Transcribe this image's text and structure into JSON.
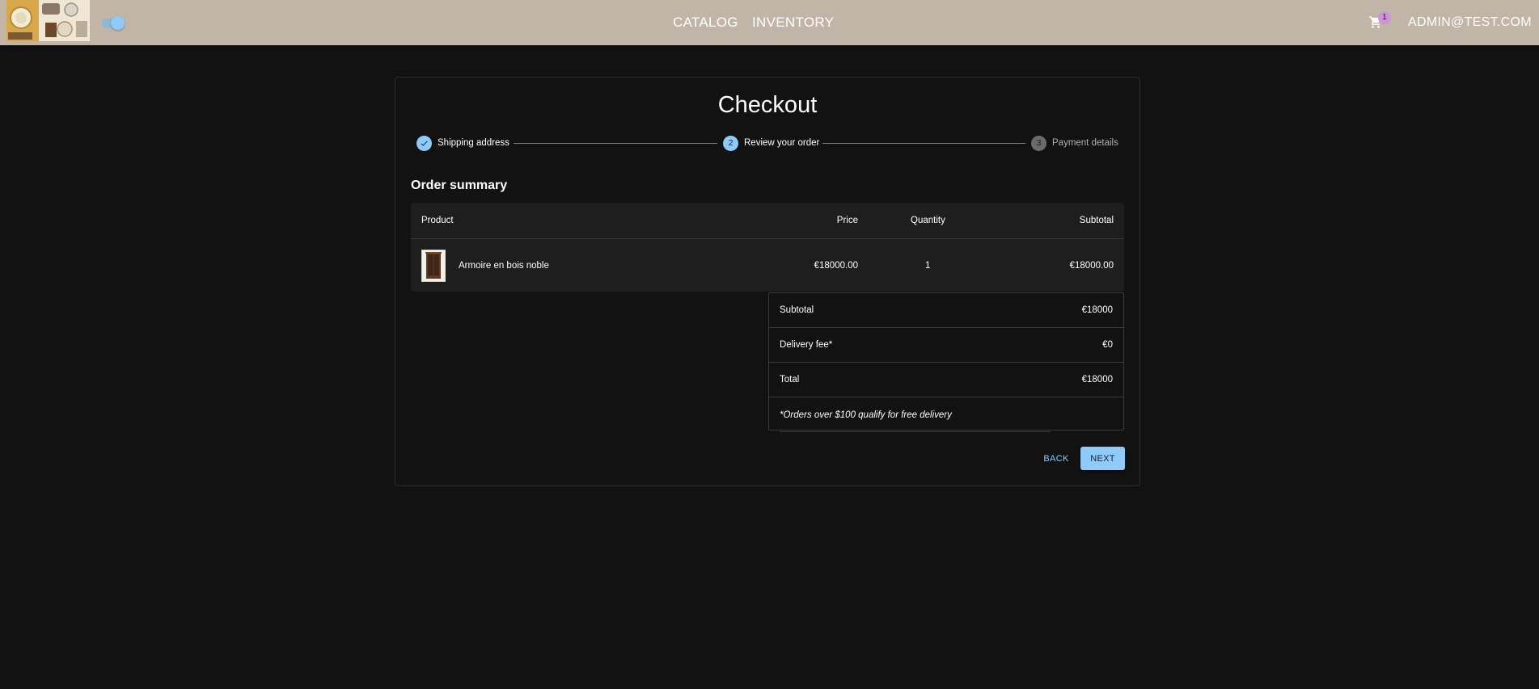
{
  "header": {
    "nav": [
      "CATALOG",
      "INVENTORY"
    ],
    "cart_count": "1",
    "user": "ADMIN@TEST.COM"
  },
  "checkout": {
    "title": "Checkout",
    "steps": [
      {
        "label": "Shipping address",
        "number": "",
        "state": "completed"
      },
      {
        "label": "Review your order",
        "number": "2",
        "state": "active"
      },
      {
        "label": "Payment details",
        "number": "3",
        "state": "pending"
      }
    ],
    "section_title": "Order summary",
    "table": {
      "headers": [
        "Product",
        "Price",
        "Quantity",
        "Subtotal"
      ],
      "rows": [
        {
          "product": "Armoire en bois noble",
          "price": "€18000.00",
          "quantity": "1",
          "subtotal": "€18000.00"
        }
      ]
    },
    "summary": {
      "subtotal_label": "Subtotal",
      "subtotal_value": "€18000",
      "delivery_label": "Delivery fee*",
      "delivery_value": "€0",
      "total_label": "Total",
      "total_value": "€18000",
      "note": "*Orders over $100 qualify for free delivery"
    },
    "buttons": {
      "back": "Back",
      "next": "Next"
    }
  },
  "colors": {
    "appbar": "#c1b5a8",
    "background": "#121212",
    "primary": "#90caf9",
    "badge": "#ce93d8"
  }
}
